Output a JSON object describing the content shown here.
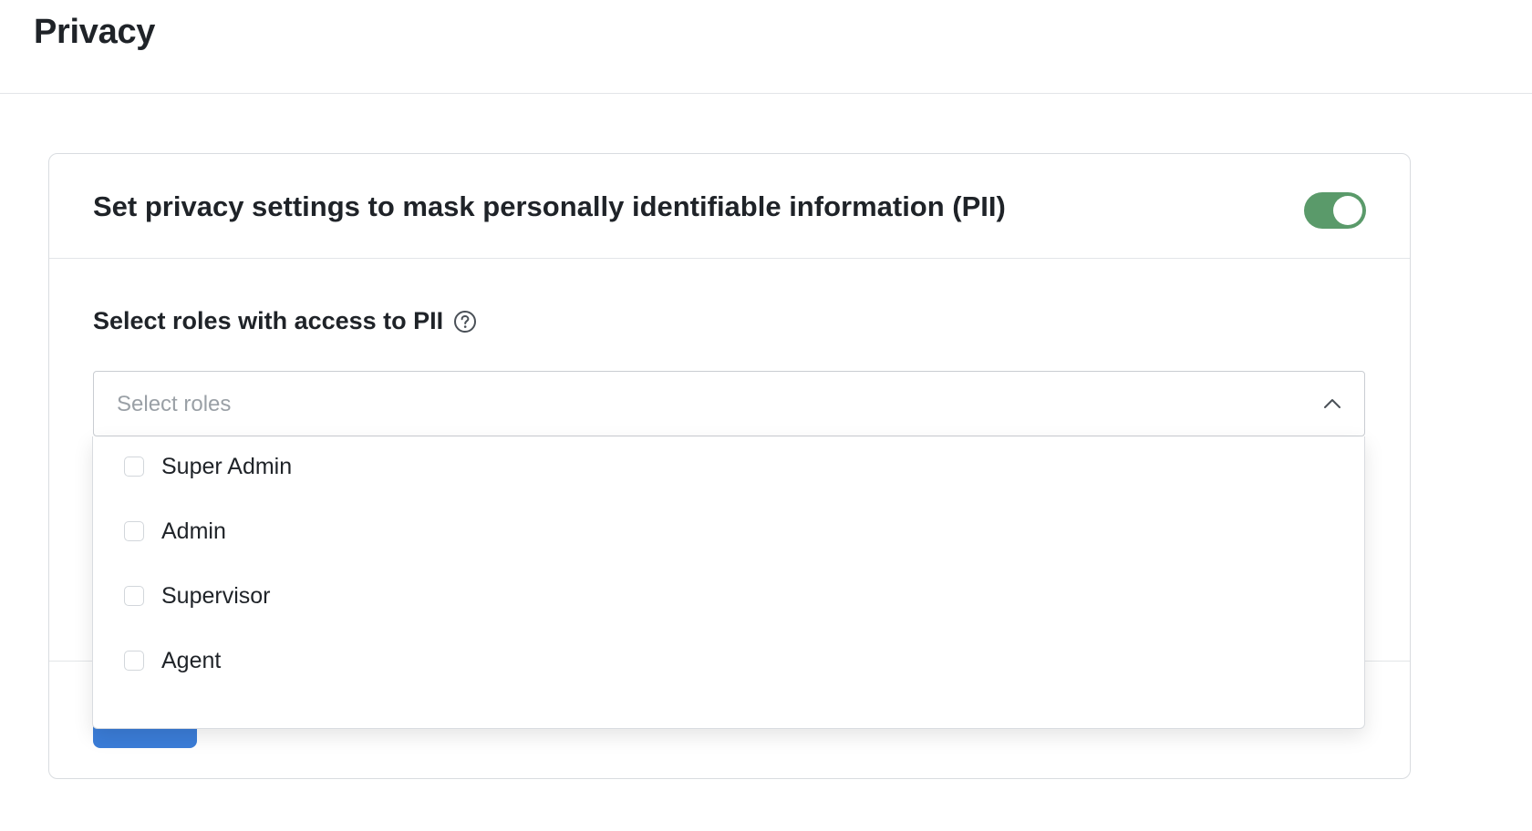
{
  "page": {
    "title": "Privacy"
  },
  "pii_settings": {
    "title": "Set privacy settings to mask personally identifiable information (PII)",
    "toggle_enabled": true,
    "toggle_color": "#5a9a6a",
    "toggle_icon": "toggle-switch-on"
  },
  "roles_field": {
    "label": "Select roles with access to PII",
    "help_icon": "question-circle-icon",
    "placeholder": "Select roles",
    "chevron_icon": "chevron-up-icon",
    "dropdown_open": true,
    "options": [
      {
        "label": "Super Admin",
        "checked": false
      },
      {
        "label": "Admin",
        "checked": false
      },
      {
        "label": "Supervisor",
        "checked": false
      },
      {
        "label": "Agent",
        "checked": false
      }
    ]
  },
  "actions": {
    "save_label": "",
    "save_color": "#3b7dd8"
  }
}
